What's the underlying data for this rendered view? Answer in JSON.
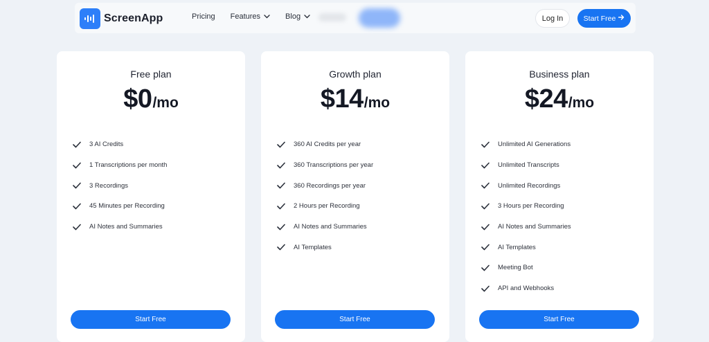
{
  "nav": {
    "brand": "ScreenApp",
    "links": [
      {
        "label": "Pricing",
        "has_dropdown": false
      },
      {
        "label": "Features",
        "has_dropdown": true
      },
      {
        "label": "Blog",
        "has_dropdown": true
      }
    ],
    "login_label": "Log In",
    "start_free_label": "Start Free",
    "start_free_icon": "arrow-right-icon"
  },
  "colors": {
    "accent": "#1874f2",
    "page_bg": "#eef2f7",
    "card_bg": "#ffffff"
  },
  "plans": [
    {
      "name": "Free plan",
      "price": "$0",
      "period": "/mo",
      "features": [
        "3 AI Credits",
        "1 Transcriptions per month",
        "3 Recordings",
        "45 Minutes per Recording",
        "AI Notes and Summaries"
      ],
      "cta": "Start Free"
    },
    {
      "name": "Growth plan",
      "price": "$14",
      "period": "/mo",
      "features": [
        "360 AI Credits per year",
        "360 Transcriptions per year",
        "360 Recordings per year",
        "2 Hours per Recording",
        "AI Notes and Summaries",
        "AI Templates"
      ],
      "cta": "Start Free"
    },
    {
      "name": "Business plan",
      "price": "$24",
      "period": "/mo",
      "features": [
        "Unlimited AI Generations",
        "Unlimited Transcripts",
        "Unlimited Recordings",
        "3 Hours per Recording",
        "AI Notes and Summaries",
        "AI Templates",
        "Meeting Bot",
        "API and Webhooks"
      ],
      "cta": "Start Free"
    }
  ]
}
